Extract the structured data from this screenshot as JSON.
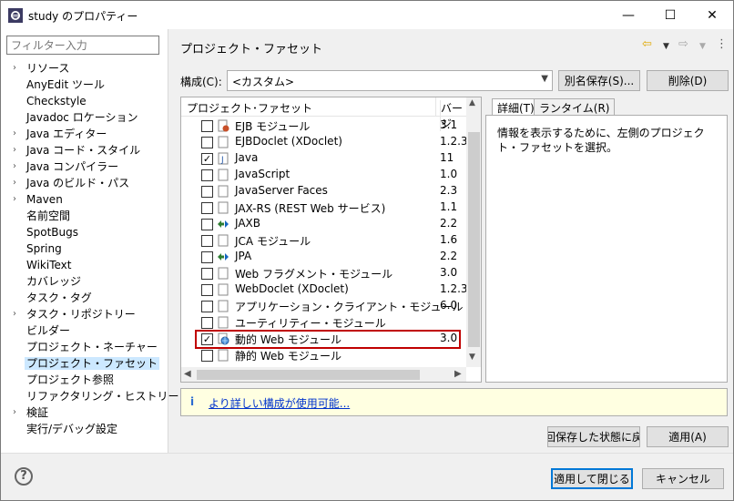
{
  "window": {
    "title": "study のプロパティー",
    "minimize": "—",
    "maximize": "☐",
    "close": "✕"
  },
  "sidebar": {
    "filter_placeholder": "フィルター入力",
    "items": [
      {
        "label": "リソース",
        "expandable": true
      },
      {
        "label": "AnyEdit ツール",
        "expandable": false
      },
      {
        "label": "Checkstyle",
        "expandable": false
      },
      {
        "label": "Javadoc ロケーション",
        "expandable": false
      },
      {
        "label": "Java エディター",
        "expandable": true
      },
      {
        "label": "Java コード・スタイル",
        "expandable": true
      },
      {
        "label": "Java コンパイラー",
        "expandable": true
      },
      {
        "label": "Java のビルド・パス",
        "expandable": true
      },
      {
        "label": "Maven",
        "expandable": true
      },
      {
        "label": "名前空間",
        "expandable": false
      },
      {
        "label": "SpotBugs",
        "expandable": false
      },
      {
        "label": "Spring",
        "expandable": false
      },
      {
        "label": "WikiText",
        "expandable": false
      },
      {
        "label": "カバレッジ",
        "expandable": false
      },
      {
        "label": "タスク・タグ",
        "expandable": false
      },
      {
        "label": "タスク・リポジトリー",
        "expandable": true
      },
      {
        "label": "ビルダー",
        "expandable": false
      },
      {
        "label": "プロジェクト・ネーチャー",
        "expandable": false
      },
      {
        "label": "プロジェクト・ファセット",
        "expandable": false,
        "selected": true
      },
      {
        "label": "プロジェクト参照",
        "expandable": false
      },
      {
        "label": "リファクタリング・ヒストリー",
        "expandable": false
      },
      {
        "label": "検証",
        "expandable": true
      },
      {
        "label": "実行/デバッグ設定",
        "expandable": false
      }
    ]
  },
  "page": {
    "title": "プロジェクト・ファセット",
    "config_label": "構成(C):",
    "config_value": "<カスタム>",
    "save_as_label": "別名保存(S)...",
    "delete_label": "削除(D)"
  },
  "facets": {
    "header_name": "プロジェクト･ファセット",
    "header_version": "バージ",
    "rows": [
      {
        "name": "EJB モジュール",
        "version": "3.1",
        "checked": false,
        "icon": "ejb-icon"
      },
      {
        "name": "EJBDoclet (XDoclet)",
        "version": "1.2.3",
        "checked": false,
        "icon": "page-icon"
      },
      {
        "name": "Java",
        "version": "11",
        "checked": true,
        "icon": "java-icon"
      },
      {
        "name": "JavaScript",
        "version": "1.0",
        "checked": false,
        "icon": "page-icon"
      },
      {
        "name": "JavaServer Faces",
        "version": "2.3",
        "checked": false,
        "icon": "page-icon"
      },
      {
        "name": "JAX-RS (REST Web サービス)",
        "version": "1.1",
        "checked": false,
        "icon": "page-icon"
      },
      {
        "name": "JAXB",
        "version": "2.2",
        "checked": false,
        "icon": "arrows-icon"
      },
      {
        "name": "JCA モジュール",
        "version": "1.6",
        "checked": false,
        "icon": "page-icon"
      },
      {
        "name": "JPA",
        "version": "2.2",
        "checked": false,
        "icon": "arrows-icon"
      },
      {
        "name": "Web フラグメント・モジュール",
        "version": "3.0",
        "checked": false,
        "icon": "page-icon"
      },
      {
        "name": "WebDoclet (XDoclet)",
        "version": "1.2.3",
        "checked": false,
        "icon": "page-icon"
      },
      {
        "name": "アプリケーション・クライアント・モジュール",
        "version": "6.0",
        "checked": false,
        "icon": "page-icon"
      },
      {
        "name": "ユーティリティー・モジュール",
        "version": "",
        "checked": false,
        "icon": "page-icon"
      },
      {
        "name": "動的 Web モジュール",
        "version": "3.0",
        "checked": true,
        "icon": "globe-icon"
      },
      {
        "name": "静的 Web モジュール",
        "version": "",
        "checked": false,
        "icon": "page-icon"
      }
    ]
  },
  "details": {
    "tab_details": "詳細(T)",
    "tab_runtime": "ランタイム(R)",
    "text": "情報を表示するために、左側のプロジェクト・ファセットを選択。"
  },
  "info": {
    "icon": "i",
    "link": "より詳しい構成が使用可能..."
  },
  "actions": {
    "restore": "回保存した状態に戻",
    "apply": "適用(A)",
    "apply_close": "適用して閉じる",
    "cancel": "キャンセル",
    "help": "?"
  },
  "colors": {
    "selection": "#cce8ff",
    "highlight_border": "#c00000",
    "info_bg": "#ffffe1",
    "link": "#0033cc"
  }
}
